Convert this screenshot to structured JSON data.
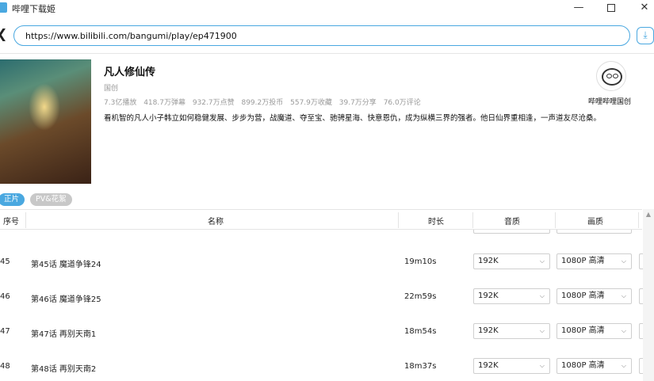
{
  "window": {
    "title": "哔哩下载姬"
  },
  "address": {
    "url": "https://www.bilibili.com/bangumi/play/ep471900"
  },
  "info": {
    "title": "凡人修仙传",
    "type": "国创",
    "stats": [
      "7.3亿播放",
      "418.7万弹幕",
      "932.7万点赞",
      "899.2万投币",
      "557.9万收藏",
      "39.7万分享",
      "76.0万评论"
    ],
    "description": "看机智的凡人小子韩立如何稳健发展、步步为营，战魔道、夺至宝、驰骋星海、快意恩仇，成为纵横三界的强者。他日仙界重相逢，一声道友尽沧桑。",
    "uploader": "哔哩哔哩国创"
  },
  "tabs": [
    {
      "label": "正片",
      "active": true
    },
    {
      "label": "PV&花絮",
      "active": false
    }
  ],
  "table": {
    "headers": {
      "index": "序号",
      "name": "名称",
      "duration": "时长",
      "audio": "音质",
      "video": "画质"
    },
    "rows": [
      {
        "index": "45",
        "name": "第45话 魔道争锋24",
        "duration": "19m10s",
        "audio": "192K",
        "video": "1080P 高清"
      },
      {
        "index": "46",
        "name": "第46话 魔道争锋25",
        "duration": "22m59s",
        "audio": "192K",
        "video": "1080P 高清"
      },
      {
        "index": "47",
        "name": "第47话 再别天南1",
        "duration": "18m54s",
        "audio": "192K",
        "video": "1080P 高清"
      },
      {
        "index": "48",
        "name": "第48话 再别天南2",
        "duration": "18m37s",
        "audio": "192K",
        "video": "1080P 高清"
      }
    ]
  },
  "colors": {
    "accent": "#4aa8e0",
    "tab_inactive": "#c8c8c8"
  }
}
